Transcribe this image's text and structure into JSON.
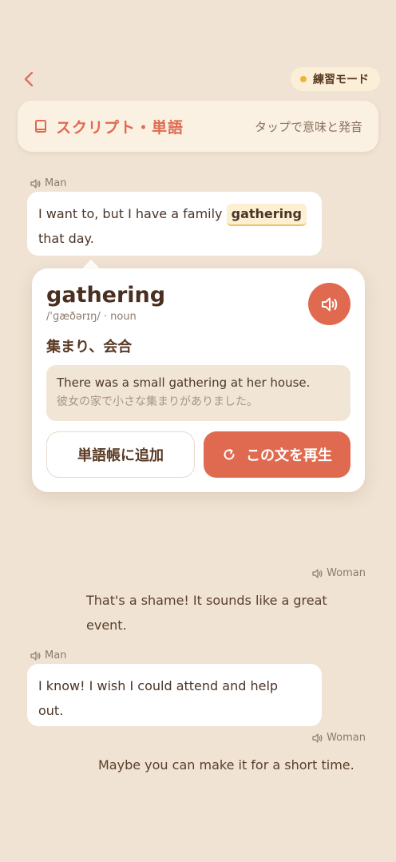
{
  "header": {
    "title": "スクリプト・単語",
    "hint": "タップで意味と発音",
    "mode_badge": "練習モード"
  },
  "icons": {
    "back": "chevron-left-icon",
    "book": "book-icon",
    "speaker": "speaker-icon",
    "replay": "replay-icon"
  },
  "colors": {
    "accent": "#E06A50",
    "badge_dot": "#F0B23C",
    "background": "#F0E3D3"
  },
  "dialogue": [
    {
      "speaker": "Man",
      "line1_before": "I want to, but I have a family",
      "highlight": "gathering",
      "line2": "that day."
    },
    {
      "speaker": "Woman",
      "line1": "That's a shame! It sounds like a great",
      "line2": "event."
    },
    {
      "speaker": "Man",
      "line1": "I know! I wish I could attend and help",
      "line2": "out."
    },
    {
      "speaker": "Woman",
      "line1": "Maybe you can make it for a short time."
    }
  ],
  "popup": {
    "word": "gathering",
    "pronunciation": "/ˈɡæðərɪŋ/ · noun",
    "meaning": "集まり、会合",
    "example_en": "There was a small gathering at her house.",
    "example_ja": "彼女の家で小さな集まりがありました。",
    "add_button": "単語帳に追加",
    "play_button": "この文を再生"
  }
}
